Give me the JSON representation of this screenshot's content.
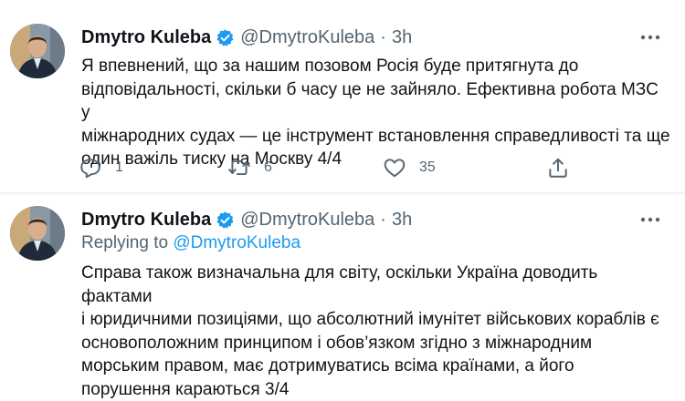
{
  "tweets": [
    {
      "author": {
        "name": "Dmytro Kuleba",
        "handle": "@DmytroKuleba",
        "verified": true
      },
      "separator": "·",
      "time": "3h",
      "text": "Я впевнений, що за нашим позовом Росія буде притягнута до\nвідповідальності, скільки б часу це не зайняло. Ефективна робота МЗС у\nміжнародних судах — це інструмент встановлення справедливості та ще\nодин важіль тиску на Москву 4/4",
      "actions": {
        "reply_count": "1",
        "retweet_count": "6",
        "like_count": "35"
      },
      "icons": [
        "reply-icon",
        "retweet-icon",
        "like-icon",
        "share-icon",
        "more-icon",
        "verified-icon"
      ]
    },
    {
      "author": {
        "name": "Dmytro Kuleba",
        "handle": "@DmytroKuleba",
        "verified": true
      },
      "separator": "·",
      "time": "3h",
      "reply_prefix": "Replying to ",
      "reply_to": "@DmytroKuleba",
      "text": "Справа також визначальна для світу, оскільки Україна доводить фактами\nі юридичними позиціями, що абсолютний імунітет військових кораблів є\nосновоположним принципом і обов’язком згідно з міжнародним\nморським правом, має дотримуватись всіма країнами, а його\nпорушення караються 3/4"
    }
  ],
  "colors": {
    "text": "#0f1419",
    "secondary": "#536471",
    "accent": "#1d9bf0",
    "divider": "#eff3f4"
  }
}
